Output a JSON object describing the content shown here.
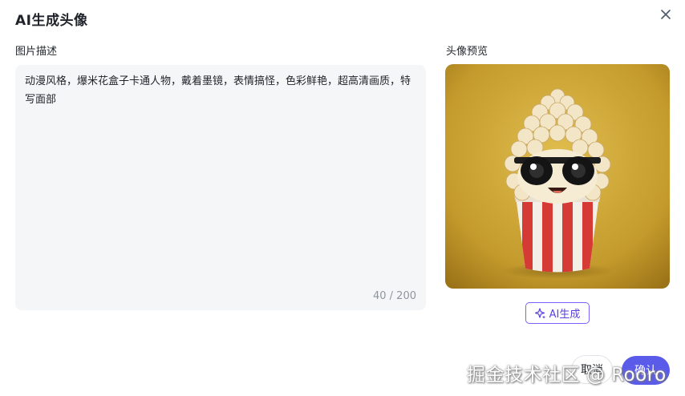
{
  "dialog": {
    "title": "AI生成头像",
    "close_icon": "close-icon"
  },
  "description": {
    "label": "图片描述",
    "text": "动漫风格，爆米花盒子卡通人物，戴着墨镜，表情搞怪，色彩鲜艳，超高清画质，特写面部",
    "count": "40 / 200"
  },
  "preview": {
    "label": "头像预览",
    "image_subject": "cartoon popcorn box character wearing sunglasses",
    "background_color": "#c9a23a"
  },
  "actions": {
    "ai_generate_label": "AI生成",
    "ai_generate_icon": "sparkle-icon",
    "cancel_label": "取消",
    "confirm_label": "确认"
  },
  "watermark": {
    "text": "掘金技术社区 @ Rooro"
  },
  "colors": {
    "accent": "#5b5bea",
    "ai_button_border": "#7b61ff",
    "input_background": "#f5f6f8",
    "counter_text": "#8f959e"
  }
}
